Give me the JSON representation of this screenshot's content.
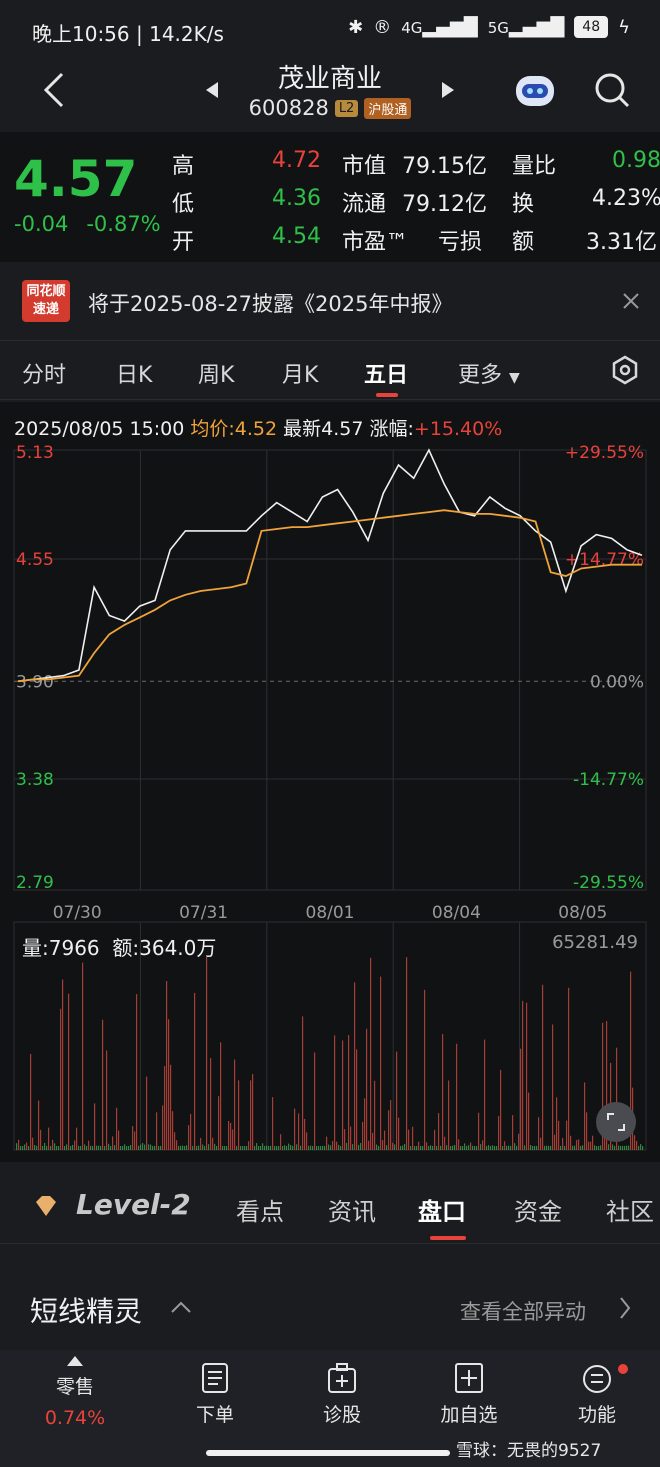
{
  "status_bar": {
    "time": "晚上10:56",
    "speed": "14.2K/s",
    "net1": "4G",
    "net2": "5G",
    "battery": "48"
  },
  "header": {
    "title": "茂业商业",
    "code": "600828",
    "tag_l2": "L2",
    "tag_connect": "沪股通"
  },
  "quote": {
    "price": "4.57",
    "change": "-0.04",
    "change_pct": "-0.87%",
    "high_label": "高",
    "high": "4.72",
    "low_label": "低",
    "low": "4.36",
    "open_label": "开",
    "open": "4.54",
    "mcap_label": "市值",
    "mcap": "79.15亿",
    "float_label": "流通",
    "float": "79.12亿",
    "pe_label": "市盈™",
    "pe": "亏损",
    "vr_label": "量比",
    "vr": "0.98",
    "turn_label": "换",
    "turn": "4.23%",
    "amt_label": "额",
    "amt": "3.31亿"
  },
  "banner": {
    "badge_line1": "同花顺",
    "badge_line2": "速递",
    "text": "将于2025-08-27披露《2025年中报》"
  },
  "tabs": [
    {
      "label": "分时"
    },
    {
      "label": "日K"
    },
    {
      "label": "周K"
    },
    {
      "label": "月K"
    },
    {
      "label": "五日"
    },
    {
      "label": "更多"
    }
  ],
  "chart_info": {
    "datetime": "2025/08/05 15:00",
    "avg_label": "均价:",
    "avg": "4.52",
    "latest_label": "最新",
    "latest": "4.57",
    "range_label": "涨幅:",
    "range": "+15.40%"
  },
  "chart_data": {
    "type": "line",
    "title": "",
    "y_left_ticks": [
      "5.13",
      "4.55",
      "3.90",
      "3.38",
      "2.79"
    ],
    "y_right_ticks": [
      "+29.55%",
      "+14.77%",
      "0.00%",
      "-14.77%",
      "-29.55%"
    ],
    "x_ticks": [
      "07/30",
      "07/31",
      "08/01",
      "08/04",
      "08/05"
    ],
    "ylim": [
      2.79,
      5.13
    ],
    "grid": true,
    "series": [
      {
        "values": [
          3.9,
          3.91,
          3.92,
          3.93,
          3.96,
          4.4,
          4.25,
          4.22,
          4.3,
          4.33,
          4.6,
          4.7,
          4.7,
          4.7,
          4.7,
          4.7,
          4.78,
          4.85,
          4.8,
          4.75,
          4.88,
          4.92,
          4.8,
          4.65,
          4.9,
          5.05,
          4.98,
          5.13,
          4.95,
          4.8,
          4.78,
          4.88,
          4.82,
          4.78,
          4.7,
          4.64,
          4.38,
          4.62,
          4.68,
          4.66,
          4.6,
          4.57
        ]
      },
      {
        "values": [
          3.9,
          3.91,
          3.91,
          3.92,
          3.93,
          4.05,
          4.15,
          4.2,
          4.24,
          4.28,
          4.33,
          4.36,
          4.38,
          4.39,
          4.4,
          4.42,
          4.7,
          4.71,
          4.72,
          4.72,
          4.73,
          4.74,
          4.75,
          4.76,
          4.77,
          4.78,
          4.79,
          4.8,
          4.81,
          4.8,
          4.79,
          4.79,
          4.78,
          4.77,
          4.75,
          4.48,
          4.46,
          4.5,
          4.51,
          4.52,
          4.52,
          4.52
        ]
      }
    ]
  },
  "volume": {
    "vol_label": "量:",
    "vol": "7966",
    "amt_label": "额:",
    "amt": "364.0万",
    "max": "65281.49"
  },
  "subtabs": [
    {
      "label": "Level-2"
    },
    {
      "label": "看点"
    },
    {
      "label": "资讯"
    },
    {
      "label": "盘口"
    },
    {
      "label": "资金"
    },
    {
      "label": "社区"
    }
  ],
  "shortline": {
    "title": "短线精灵",
    "link": "查看全部异动"
  },
  "bottom_nav": {
    "retail_label": "零售",
    "retail_pct": "0.74%",
    "items": [
      {
        "label": "下单"
      },
      {
        "label": "诊股"
      },
      {
        "label": "加自选"
      },
      {
        "label": "功能"
      }
    ],
    "watermark": "雪球：无畏的9527"
  },
  "colors": {
    "up": "#e8433a",
    "down": "#2fc04a",
    "avg": "#f0a33a",
    "price_line": "#f0f0f0"
  }
}
